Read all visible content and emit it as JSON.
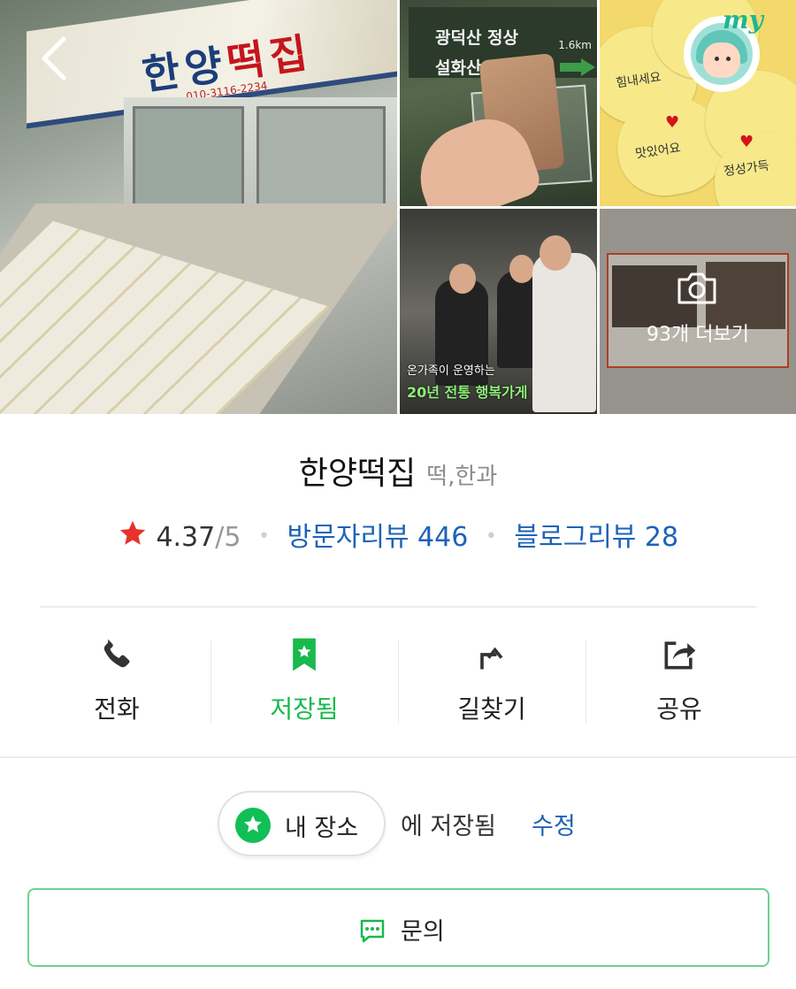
{
  "photos": {
    "main": {
      "sign_text_a": "한양",
      "sign_text_b": "떡집",
      "sign_phone": "010-3116-2234"
    },
    "trail": {
      "line1": "광덕산 정상",
      "line2": "설화산 정상",
      "distance": "1.6km"
    },
    "hearts": {
      "note1": "힘내세요",
      "note2": "정성가득",
      "note3": "맛있어요"
    },
    "kitchen": {
      "caption1": "온가족이 운영하는",
      "caption2": "20년 전통 행복가게"
    },
    "more": {
      "label": "93개 더보기"
    }
  },
  "avatar": {
    "label": "my"
  },
  "place": {
    "name": "한양떡집",
    "category": "떡,한과",
    "rating": "4.37",
    "rating_max": "/5",
    "visitor_reviews": "방문자리뷰 446",
    "blog_reviews": "블로그리뷰 28"
  },
  "actions": {
    "call": "전화",
    "saved": "저장됨",
    "directions": "길찾기",
    "share": "공유"
  },
  "saved_bar": {
    "folder": "내 장소",
    "suffix": "에 저장됨",
    "edit": "수정"
  },
  "inquiry": {
    "label": "문의"
  },
  "colors": {
    "accent_green": "#18b94d",
    "link_blue": "#1d63b8",
    "star_red": "#e8322c"
  }
}
